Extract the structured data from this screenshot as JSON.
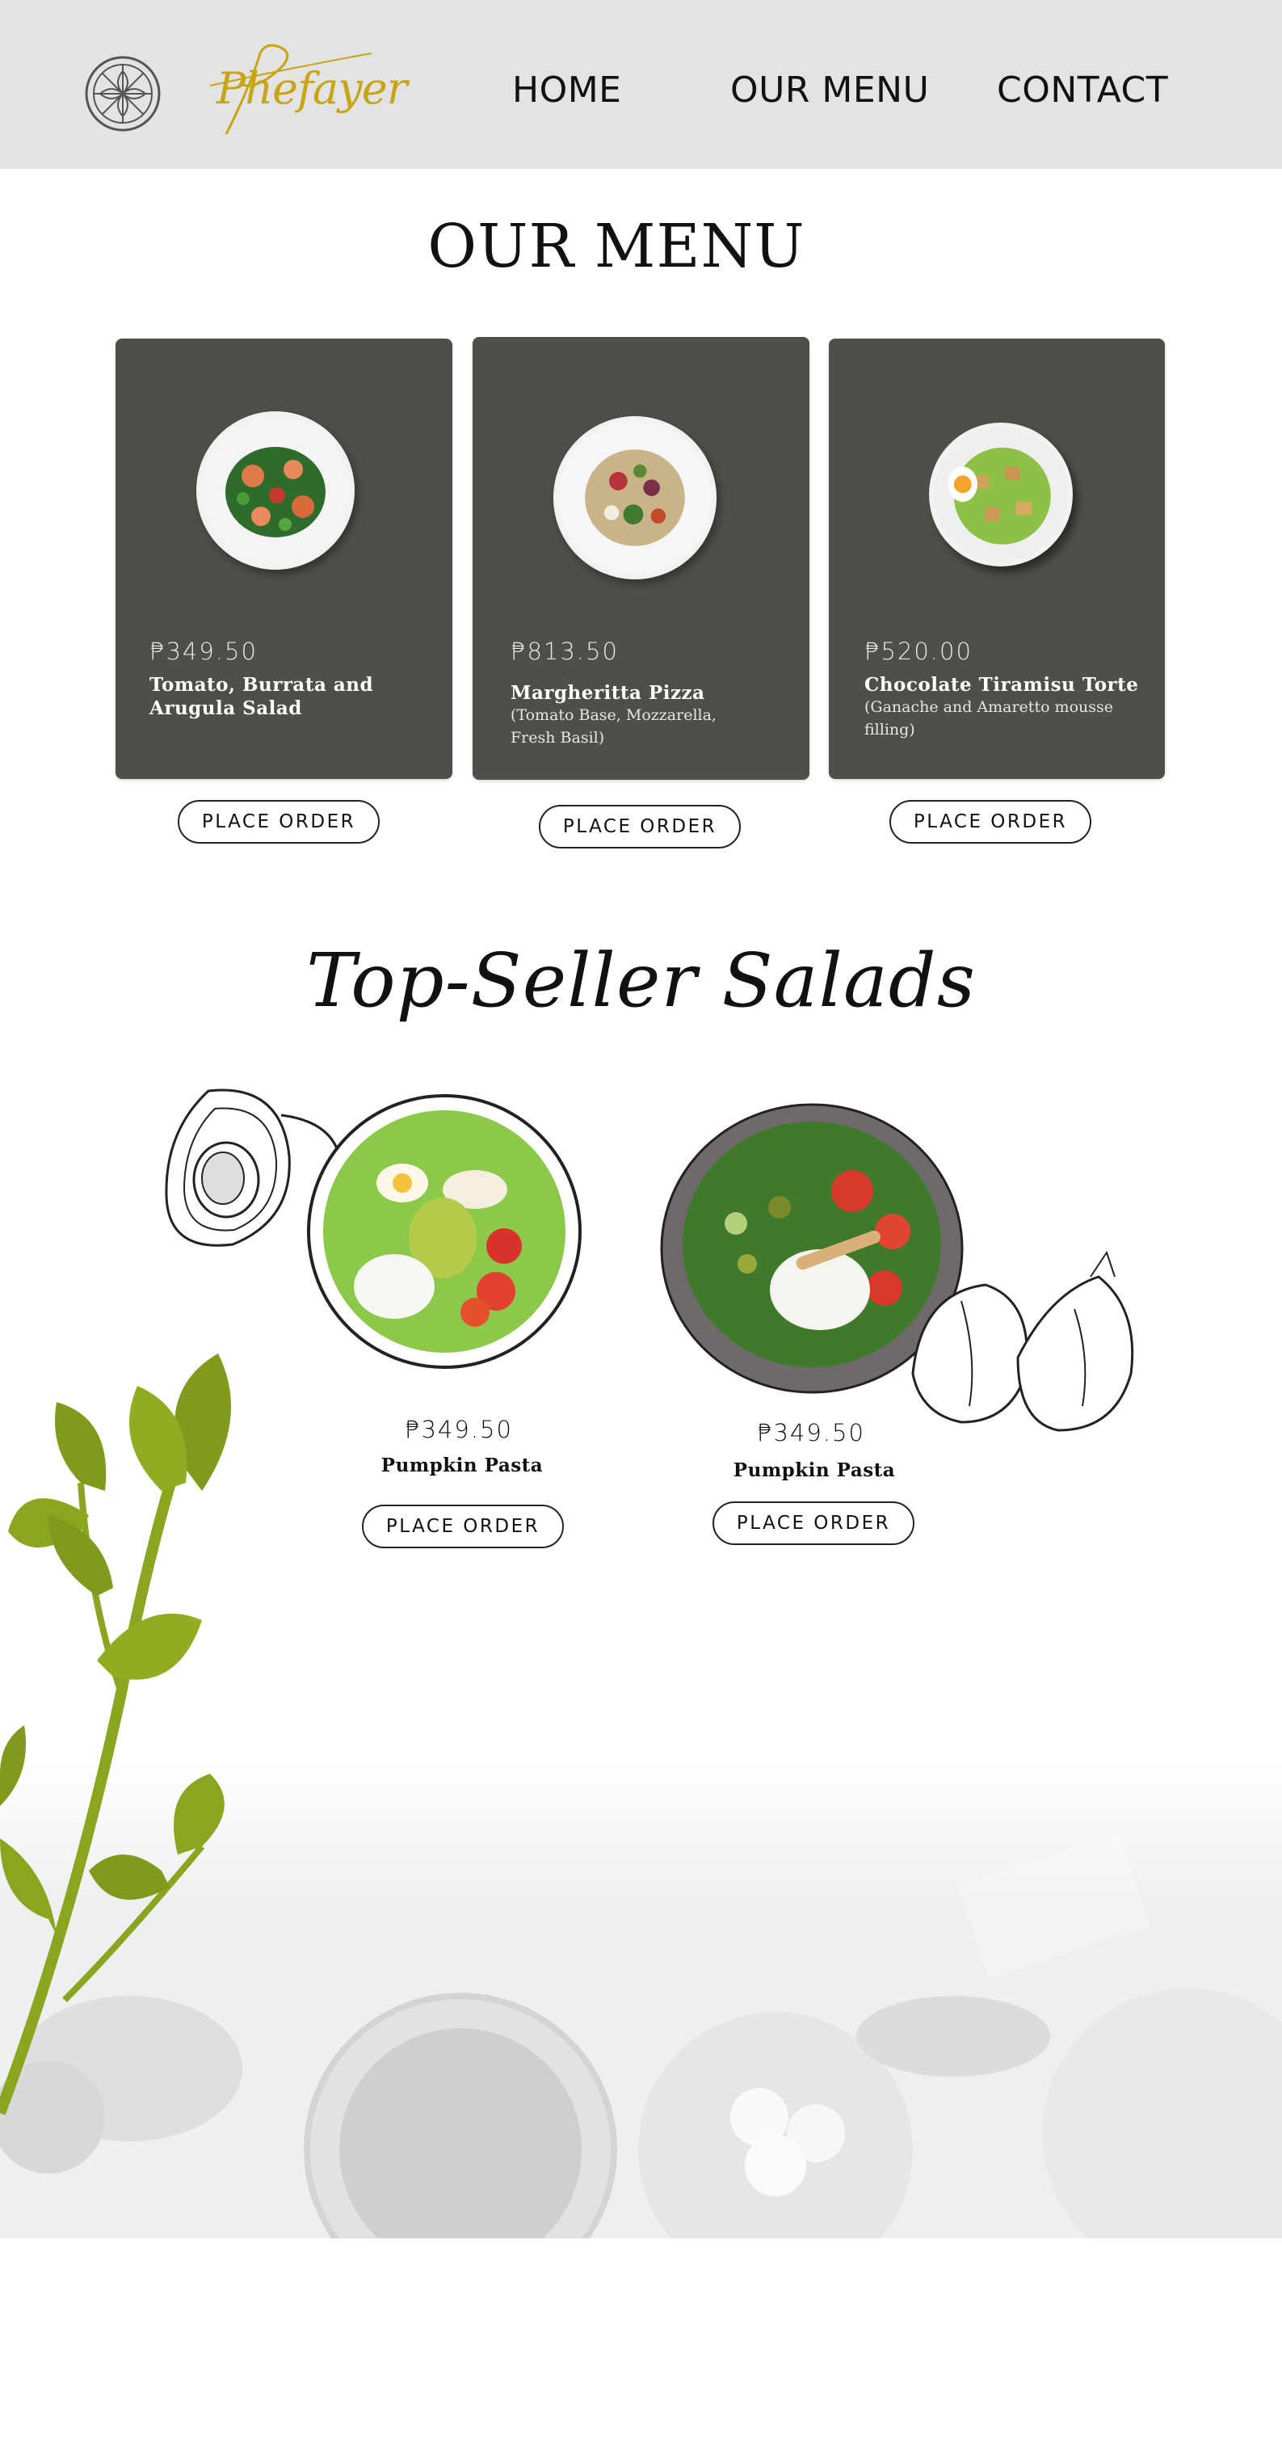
{
  "nav": {
    "logo_text": "Phefayer",
    "links": [
      "HOME",
      "OUR MENU",
      "CONTACT"
    ]
  },
  "menu": {
    "title": "OUR MENU",
    "items": [
      {
        "price": "₱349.50",
        "name": "Tomato, Burrata and Arugula Salad",
        "desc": "",
        "button": "PLACE ORDER"
      },
      {
        "price": "₱813.50",
        "name": "Margheritta Pizza",
        "desc": "(Tomato Base, Mozzarella, Fresh Basil)",
        "button": "PLACE ORDER"
      },
      {
        "price": "₱520.00",
        "name": "Chocolate Tiramisu Torte",
        "desc": "(Ganache and Amaretto mousse filling)",
        "button": "PLACE ORDER"
      }
    ]
  },
  "top_sellers": {
    "title": "Top-Seller Salads",
    "items": [
      {
        "price": "₱349.50",
        "name": "Pumpkin Pasta",
        "button": "PLACE ORDER"
      },
      {
        "price": "₱349.50",
        "name": "Pumpkin Pasta",
        "button": "PLACE ORDER"
      }
    ]
  },
  "colors": {
    "nav_bg": "#e3e3e3",
    "card_bg": "#4d5048",
    "logo_gold": "#c7a516",
    "leaf_green": "#7f9a1c"
  },
  "icons": [
    "logo-wheel-icon",
    "avocado-sketch-icon",
    "garlic-sketch-icon",
    "celery-leaf-icon"
  ]
}
